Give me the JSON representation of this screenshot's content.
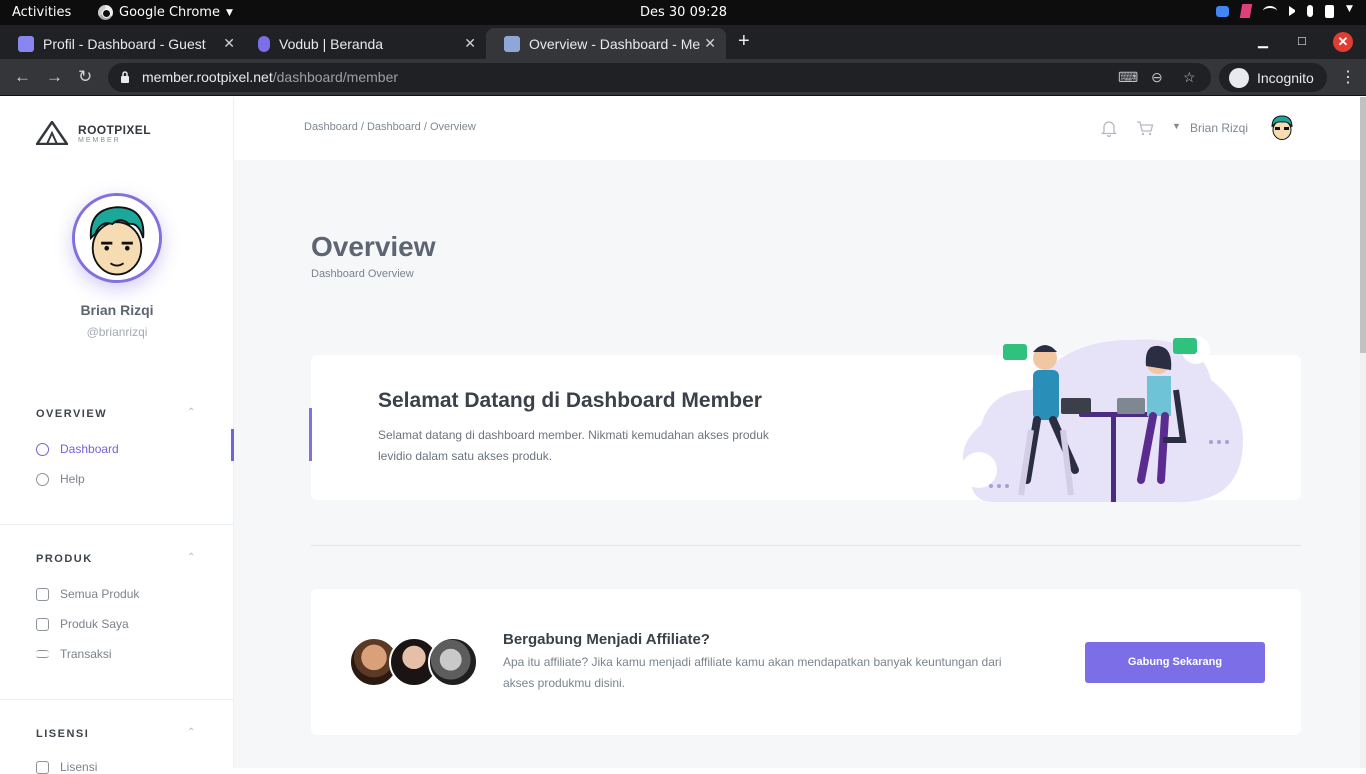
{
  "system": {
    "activities": "Activities",
    "app_name": "Google Chrome",
    "clock": "Des 30  09:28"
  },
  "browser": {
    "tabs": [
      {
        "title": "Profil - Dashboard - Guest",
        "favicon_color": "#8a86f0"
      },
      {
        "title": "Vodub | Beranda",
        "favicon_color": "#7b6ee6"
      },
      {
        "title": "Overview - Dashboard - Member",
        "favicon_color": "#8fa6d8"
      }
    ],
    "url_host": "member.rootpixel.net",
    "url_path": "/dashboard/member",
    "incognito_label": "Incognito"
  },
  "sidebar": {
    "brand_name": "ROOTPIXEL",
    "brand_sub": "MEMBER",
    "user_name": "Brian Rizqi",
    "user_handle": "@brianrizqi",
    "sections": [
      {
        "title": "OVERVIEW",
        "items": [
          {
            "label": "Dashboard",
            "icon": "gauge-icon"
          },
          {
            "label": "Help",
            "icon": "help-icon"
          }
        ]
      },
      {
        "title": "PRODUK",
        "items": [
          {
            "label": "Semua Produk",
            "icon": "box-icon"
          },
          {
            "label": "Produk Saya",
            "icon": "product-icon"
          },
          {
            "label": "Transaksi",
            "icon": "transfer-icon"
          }
        ]
      },
      {
        "title": "LISENSI",
        "items": [
          {
            "label": "Lisensi",
            "icon": "license-icon"
          }
        ]
      }
    ]
  },
  "header": {
    "breadcrumb": "Dashboard / Dashboard / Overview",
    "user_name": "Brian Rizqi"
  },
  "page": {
    "title": "Overview",
    "subtitle": "Dashboard Overview"
  },
  "welcome": {
    "title": "Selamat Datang di Dashboard Member",
    "description": "Selamat datang di dashboard member. Nikmati kemudahan akses produk levidio dalam satu akses produk."
  },
  "affiliate": {
    "title": "Bergabung Menjadi Affiliate?",
    "description": "Apa itu affiliate? Jika kamu menjadi affiliate kamu akan mendapatkan banyak keuntungan dari akses produkmu disini.",
    "button_label": "Gabung Sekarang"
  },
  "colors": {
    "accent": "#7c6ee6",
    "sidebar_active": "#7363d9"
  }
}
